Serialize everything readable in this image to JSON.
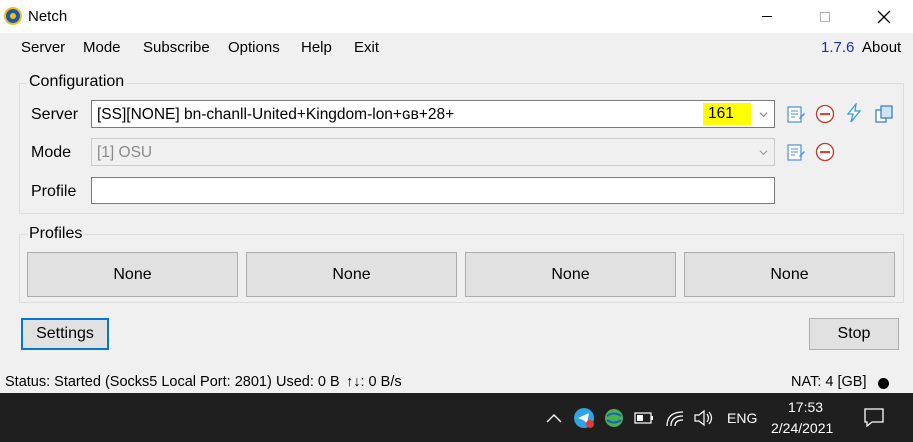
{
  "titlebar": {
    "title": "Netch"
  },
  "menu": {
    "items": [
      "Server",
      "Mode",
      "Subscribe",
      "Options",
      "Help",
      "Exit"
    ],
    "version": "1.7.6",
    "about": "About"
  },
  "configuration": {
    "title": "Configuration",
    "server_label": "Server",
    "server_value": "[SS][NONE] bn-chanll-United+Kingdom-lon+ɢʙ+28+",
    "server_count": "161",
    "mode_label": "Mode",
    "mode_value": "[1] OSU",
    "profile_label": "Profile",
    "profile_value": ""
  },
  "profiles": {
    "title": "Profiles",
    "buttons": [
      "None",
      "None",
      "None",
      "None"
    ]
  },
  "actions": {
    "settings": "Settings",
    "stop": "Stop"
  },
  "status": {
    "text": "Status: Started (Socks5 Local Port: 2801)",
    "used": "Used: 0 B",
    "speed": "↑↓: 0 B/s",
    "nat": "NAT: 4 [GB]"
  },
  "taskbar": {
    "language": "ENG",
    "time": "17:53",
    "date": "2/24/2021"
  },
  "colors": {
    "accent": "#0078d7",
    "version_link": "#1a2fb0",
    "highlight": "#ffff00"
  }
}
